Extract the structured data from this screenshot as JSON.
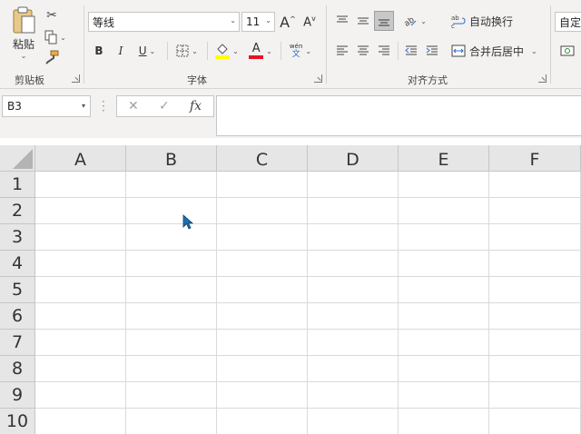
{
  "clipboard": {
    "paste_label": "粘贴",
    "group_label": "剪贴板"
  },
  "font": {
    "name": "等线",
    "size": "11",
    "bold": "B",
    "italic": "I",
    "underline": "U",
    "phonetic_top": "wén",
    "phonetic_bottom": "文",
    "group_label": "字体",
    "highlight_color": "#ffff00",
    "font_color": "#e81123"
  },
  "alignment": {
    "wrap_text": "自动换行",
    "merge_center": "合并后居中",
    "group_label": "对齐方式"
  },
  "number": {
    "format": "自定"
  },
  "formula_bar": {
    "name_box": "B3",
    "fx": "fx",
    "value": ""
  },
  "columns": [
    "A",
    "B",
    "C",
    "D",
    "E",
    "F"
  ],
  "rows": [
    "1",
    "2",
    "3",
    "4",
    "5",
    "6",
    "7",
    "8",
    "9",
    "10"
  ]
}
